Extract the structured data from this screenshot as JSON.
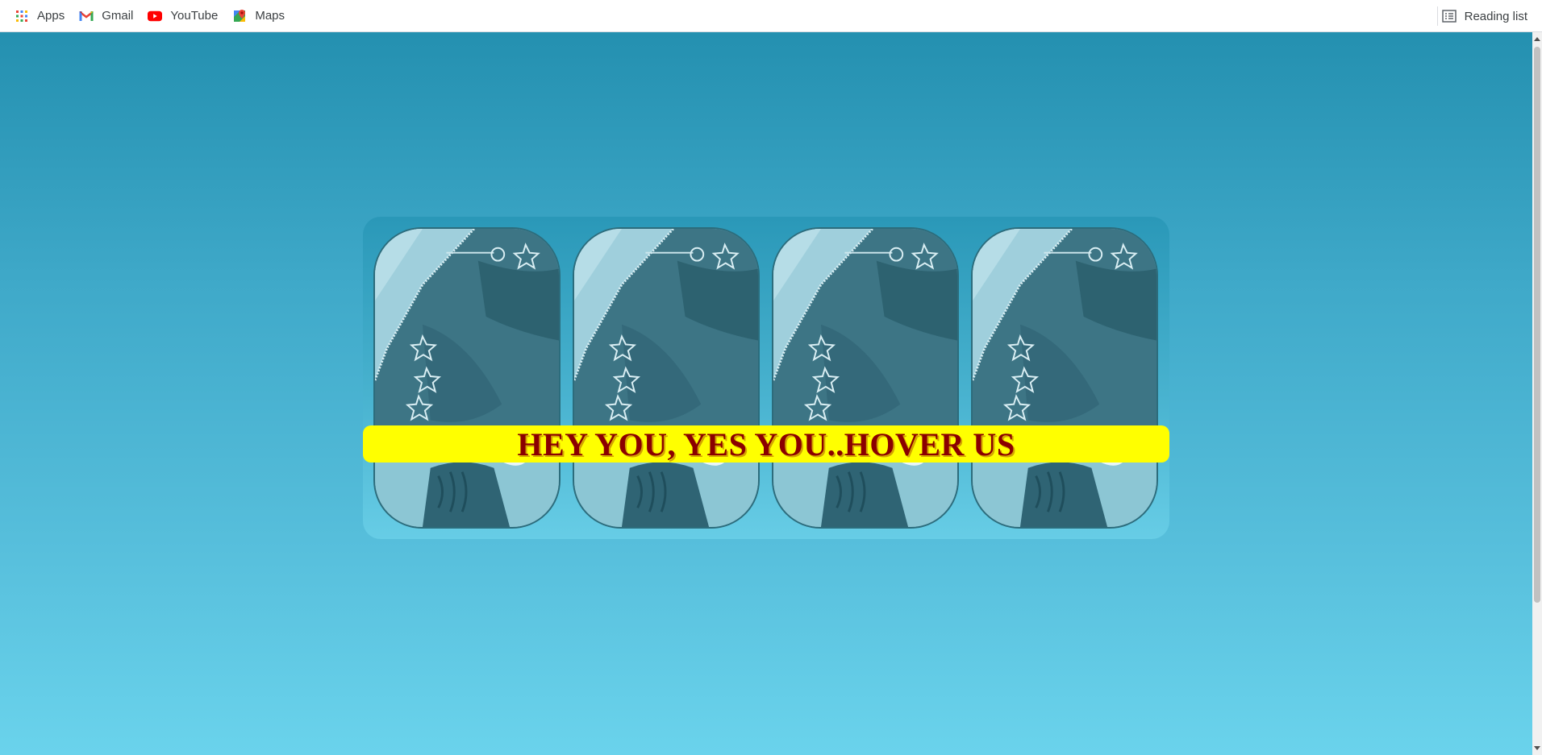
{
  "bookmarks": {
    "items": [
      {
        "label": "Apps",
        "icon": "apps-grid-icon"
      },
      {
        "label": "Gmail",
        "icon": "gmail-icon"
      },
      {
        "label": "YouTube",
        "icon": "youtube-icon"
      },
      {
        "label": "Maps",
        "icon": "maps-icon"
      }
    ],
    "reading_list": {
      "label": "Reading list",
      "icon": "reading-list-icon"
    }
  },
  "page": {
    "banner_text": "HEY YOU, YES YOU..HOVER US",
    "cards": [
      {
        "name": "photo-card-1"
      },
      {
        "name": "photo-card-2"
      },
      {
        "name": "photo-card-3"
      },
      {
        "name": "photo-card-4"
      }
    ],
    "colors": {
      "banner_bg": "#ffff00",
      "banner_text": "#8a0000",
      "bg_top": "#2490b0",
      "bg_bottom": "#6ad3ec"
    }
  }
}
